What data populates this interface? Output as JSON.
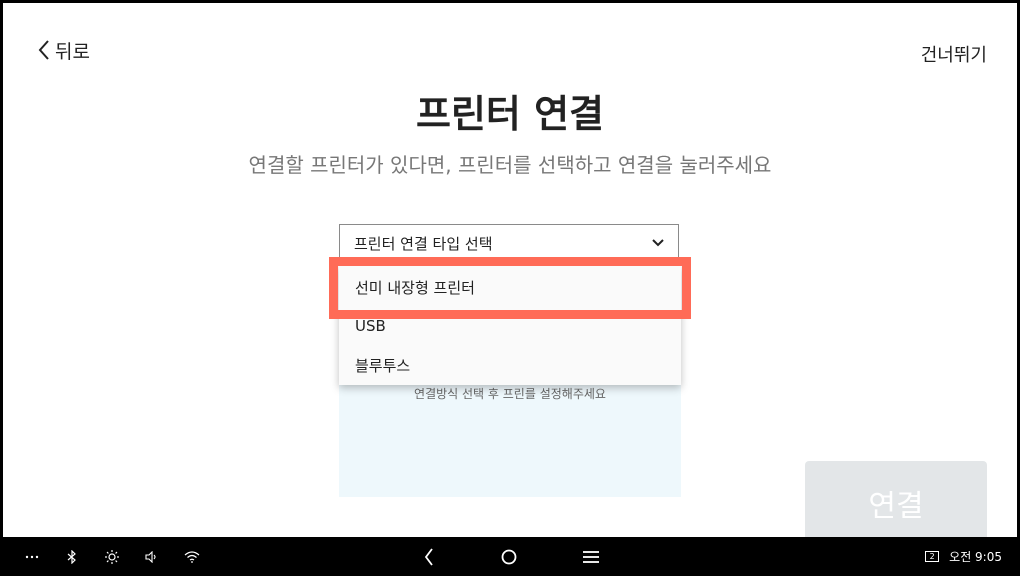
{
  "header": {
    "back_label": "뒤로",
    "skip_label": "건너뛰기"
  },
  "main": {
    "title": "프린터 연결",
    "subtitle": "연결할 프린터가 있다면, 프린터를 선택하고 연결을 눌러주세요",
    "select": {
      "placeholder": "프린터 연결 타입 선택",
      "options": [
        "선미 내장형 프린터",
        "USB",
        "블루투스"
      ],
      "highlighted_option": "선미 내장형 프린터"
    },
    "panel_text": "연결방식 선택 후 프린를 설정해주세요",
    "connect_label": "연결"
  },
  "navbar": {
    "time": "오전 9:05",
    "badge": "2",
    "icons": [
      "more-icon",
      "bluetooth-icon",
      "brightness-icon",
      "volume-icon",
      "wifi-icon",
      "nav-back-icon",
      "nav-home-icon",
      "nav-menu-icon"
    ]
  },
  "colors": {
    "highlight": "#ff6b57",
    "panel_bg": "#eef8fc",
    "button_disabled": "#e3e6e8"
  }
}
